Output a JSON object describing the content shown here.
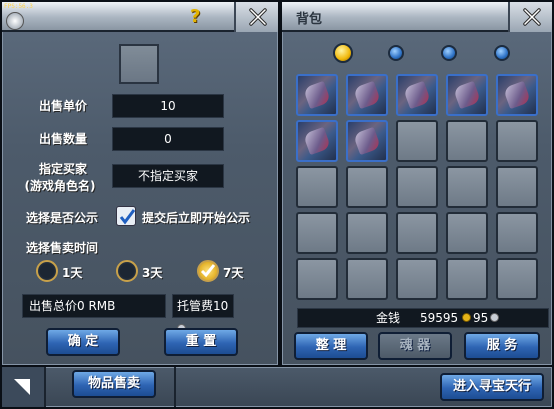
{
  "hud": {
    "fps": "FPS:56.3"
  },
  "left_panel": {
    "help_icon": "?",
    "price_label": "出售单价",
    "price_value": "10",
    "qty_label": "出售数量",
    "qty_value": "0",
    "buyer_label_1": "指定买家",
    "buyer_label_2": "(游戏角色名)",
    "buyer_value": "不指定买家",
    "public_label": "选择是否公示",
    "public_option": "提交后立即开始公示",
    "public_checked": true,
    "time_label": "选择售卖时间",
    "time_options": [
      "1天",
      "3天",
      "7天"
    ],
    "time_selected": "7天",
    "total_label": "出售总价0 RMB",
    "fee_label": "托管费",
    "fee_value": "10",
    "confirm_label": "确 定",
    "reset_label": "重 置"
  },
  "right_panel": {
    "title": "背包",
    "pages": [
      true,
      false,
      false,
      false
    ],
    "grid_items": [
      1,
      1,
      1,
      1,
      1,
      1,
      1,
      0,
      0,
      0,
      0,
      0,
      0,
      0,
      0,
      0,
      0,
      0,
      0,
      0,
      0,
      0,
      0,
      0,
      0
    ],
    "money_label": "金钱",
    "gold": "59595",
    "silver": "95",
    "sort_label": "整 理",
    "soul_label": "魂 器",
    "service_label": "服 务"
  },
  "bottom_bar": {
    "tab_label": "物品售卖",
    "treasure_label": "进入寻宝天行"
  }
}
